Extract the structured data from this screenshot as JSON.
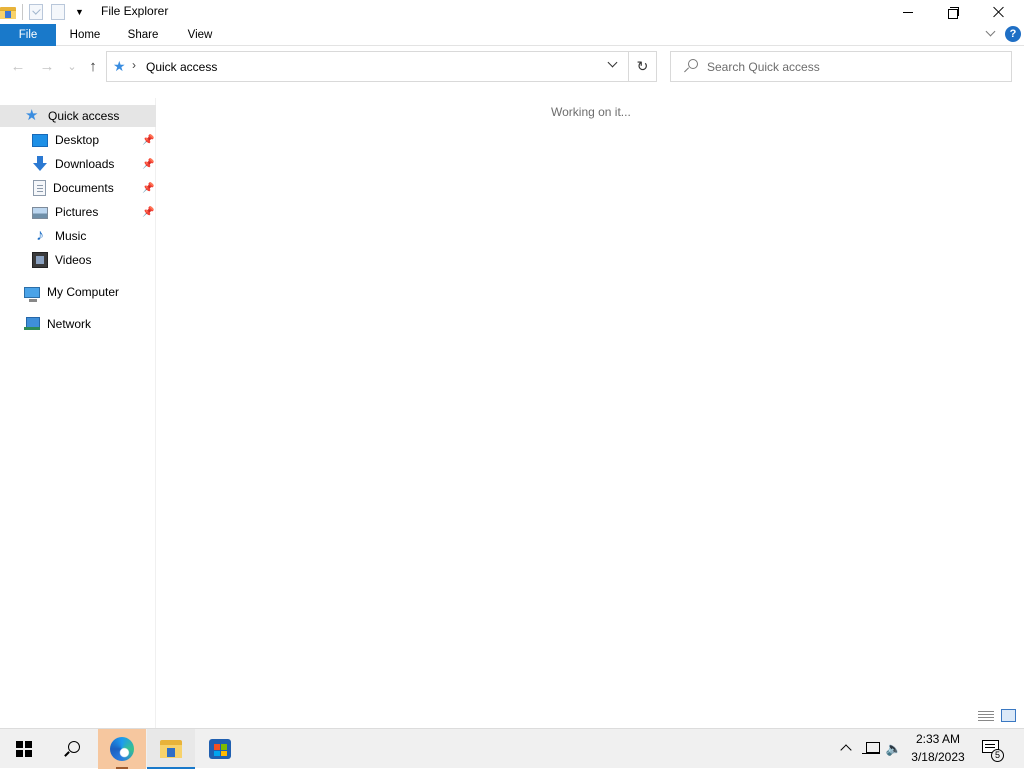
{
  "window": {
    "title": "File Explorer"
  },
  "ribbon": {
    "tabs": [
      {
        "label": "File"
      },
      {
        "label": "Home"
      },
      {
        "label": "Share"
      },
      {
        "label": "View"
      }
    ],
    "help_label": "?"
  },
  "address_bar": {
    "location": "Quick access",
    "refresh_glyph": "↻"
  },
  "search": {
    "placeholder": "Search Quick access",
    "value": ""
  },
  "nav": {
    "back_glyph": "←",
    "forward_glyph": "→",
    "recent_glyph": "⌄",
    "up_glyph": "↑"
  },
  "navigation_pane": {
    "quick_access": {
      "label": "Quick access",
      "icon": "star-icon",
      "selected": true
    },
    "pinned": [
      {
        "label": "Desktop",
        "icon": "desktop-icon",
        "pinned": true
      },
      {
        "label": "Downloads",
        "icon": "downloads-icon",
        "pinned": true
      },
      {
        "label": "Documents",
        "icon": "documents-icon",
        "pinned": true
      },
      {
        "label": "Pictures",
        "icon": "pictures-icon",
        "pinned": true
      },
      {
        "label": "Music",
        "icon": "music-icon",
        "pinned": false
      },
      {
        "label": "Videos",
        "icon": "videos-icon",
        "pinned": false
      }
    ],
    "my_computer": {
      "label": "My Computer",
      "icon": "computer-icon"
    },
    "network": {
      "label": "Network",
      "icon": "network-icon"
    }
  },
  "content": {
    "status_message": "Working on it..."
  },
  "taskbar": {
    "clock_time": "2:33 AM",
    "clock_date": "3/18/2023",
    "notification_count": "5",
    "volume_glyph": "🔈",
    "apps": [
      {
        "name": "Microsoft Edge",
        "icon": "edge-icon"
      },
      {
        "name": "File Explorer",
        "icon": "folder-icon",
        "active": true
      },
      {
        "name": "Microsoft Store",
        "icon": "store-icon"
      }
    ]
  },
  "colors": {
    "accent": "#1979ca",
    "selection": "#e5e5e5",
    "taskbar": "#f0f0f0",
    "edge_highlight": "#f6c79f"
  }
}
